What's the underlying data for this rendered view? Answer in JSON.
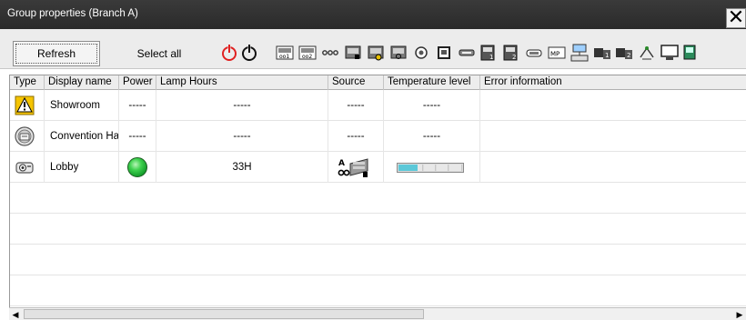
{
  "window": {
    "title": "Group properties (Branch A)",
    "close_glyph": "✕"
  },
  "toolbar": {
    "refresh_label": "Refresh",
    "select_all_label": "Select all",
    "icons": [
      "power-on-icon",
      "power-off-icon",
      "av-mute-1-icon",
      "av-mute-2-icon",
      "freeze-icon",
      "source-computer-icon",
      "source-video-icon",
      "source-s-video-icon",
      "source-component-icon",
      "source-network-icon",
      "source-usb-icon",
      "source-hdmi1-icon",
      "source-hdmi2-icon",
      "source-displayport-icon",
      "source-mp-icon",
      "network-display-icon",
      "input-1-icon",
      "input-2-icon",
      "wireless-icon",
      "monitor-icon",
      "more-icon"
    ]
  },
  "columns": [
    "Type",
    "Display name",
    "Power",
    "Lamp Hours",
    "Source",
    "Temperature level",
    "Error information"
  ],
  "rows": [
    {
      "type_icon": "warning-projector-icon",
      "name": "Showroom",
      "power": "-----",
      "lamp": "-----",
      "source": "-----",
      "temperature": "-----",
      "error": ""
    },
    {
      "type_icon": "projector-round-icon",
      "name": "Convention Ha",
      "power": "-----",
      "lamp": "-----",
      "source": "-----",
      "temperature": "-----",
      "error": ""
    },
    {
      "type_icon": "projector-icon",
      "name": "Lobby",
      "power_state": "on",
      "lamp": "33H",
      "source_icon": "source-a-computer-icon",
      "temperature_level": 0.3,
      "error": ""
    }
  ],
  "colors": {
    "power_on": "#22b14c",
    "temp_fill": "#5cc8d8",
    "titlebar": "#2f2f2f",
    "warning": "#f5c400"
  }
}
